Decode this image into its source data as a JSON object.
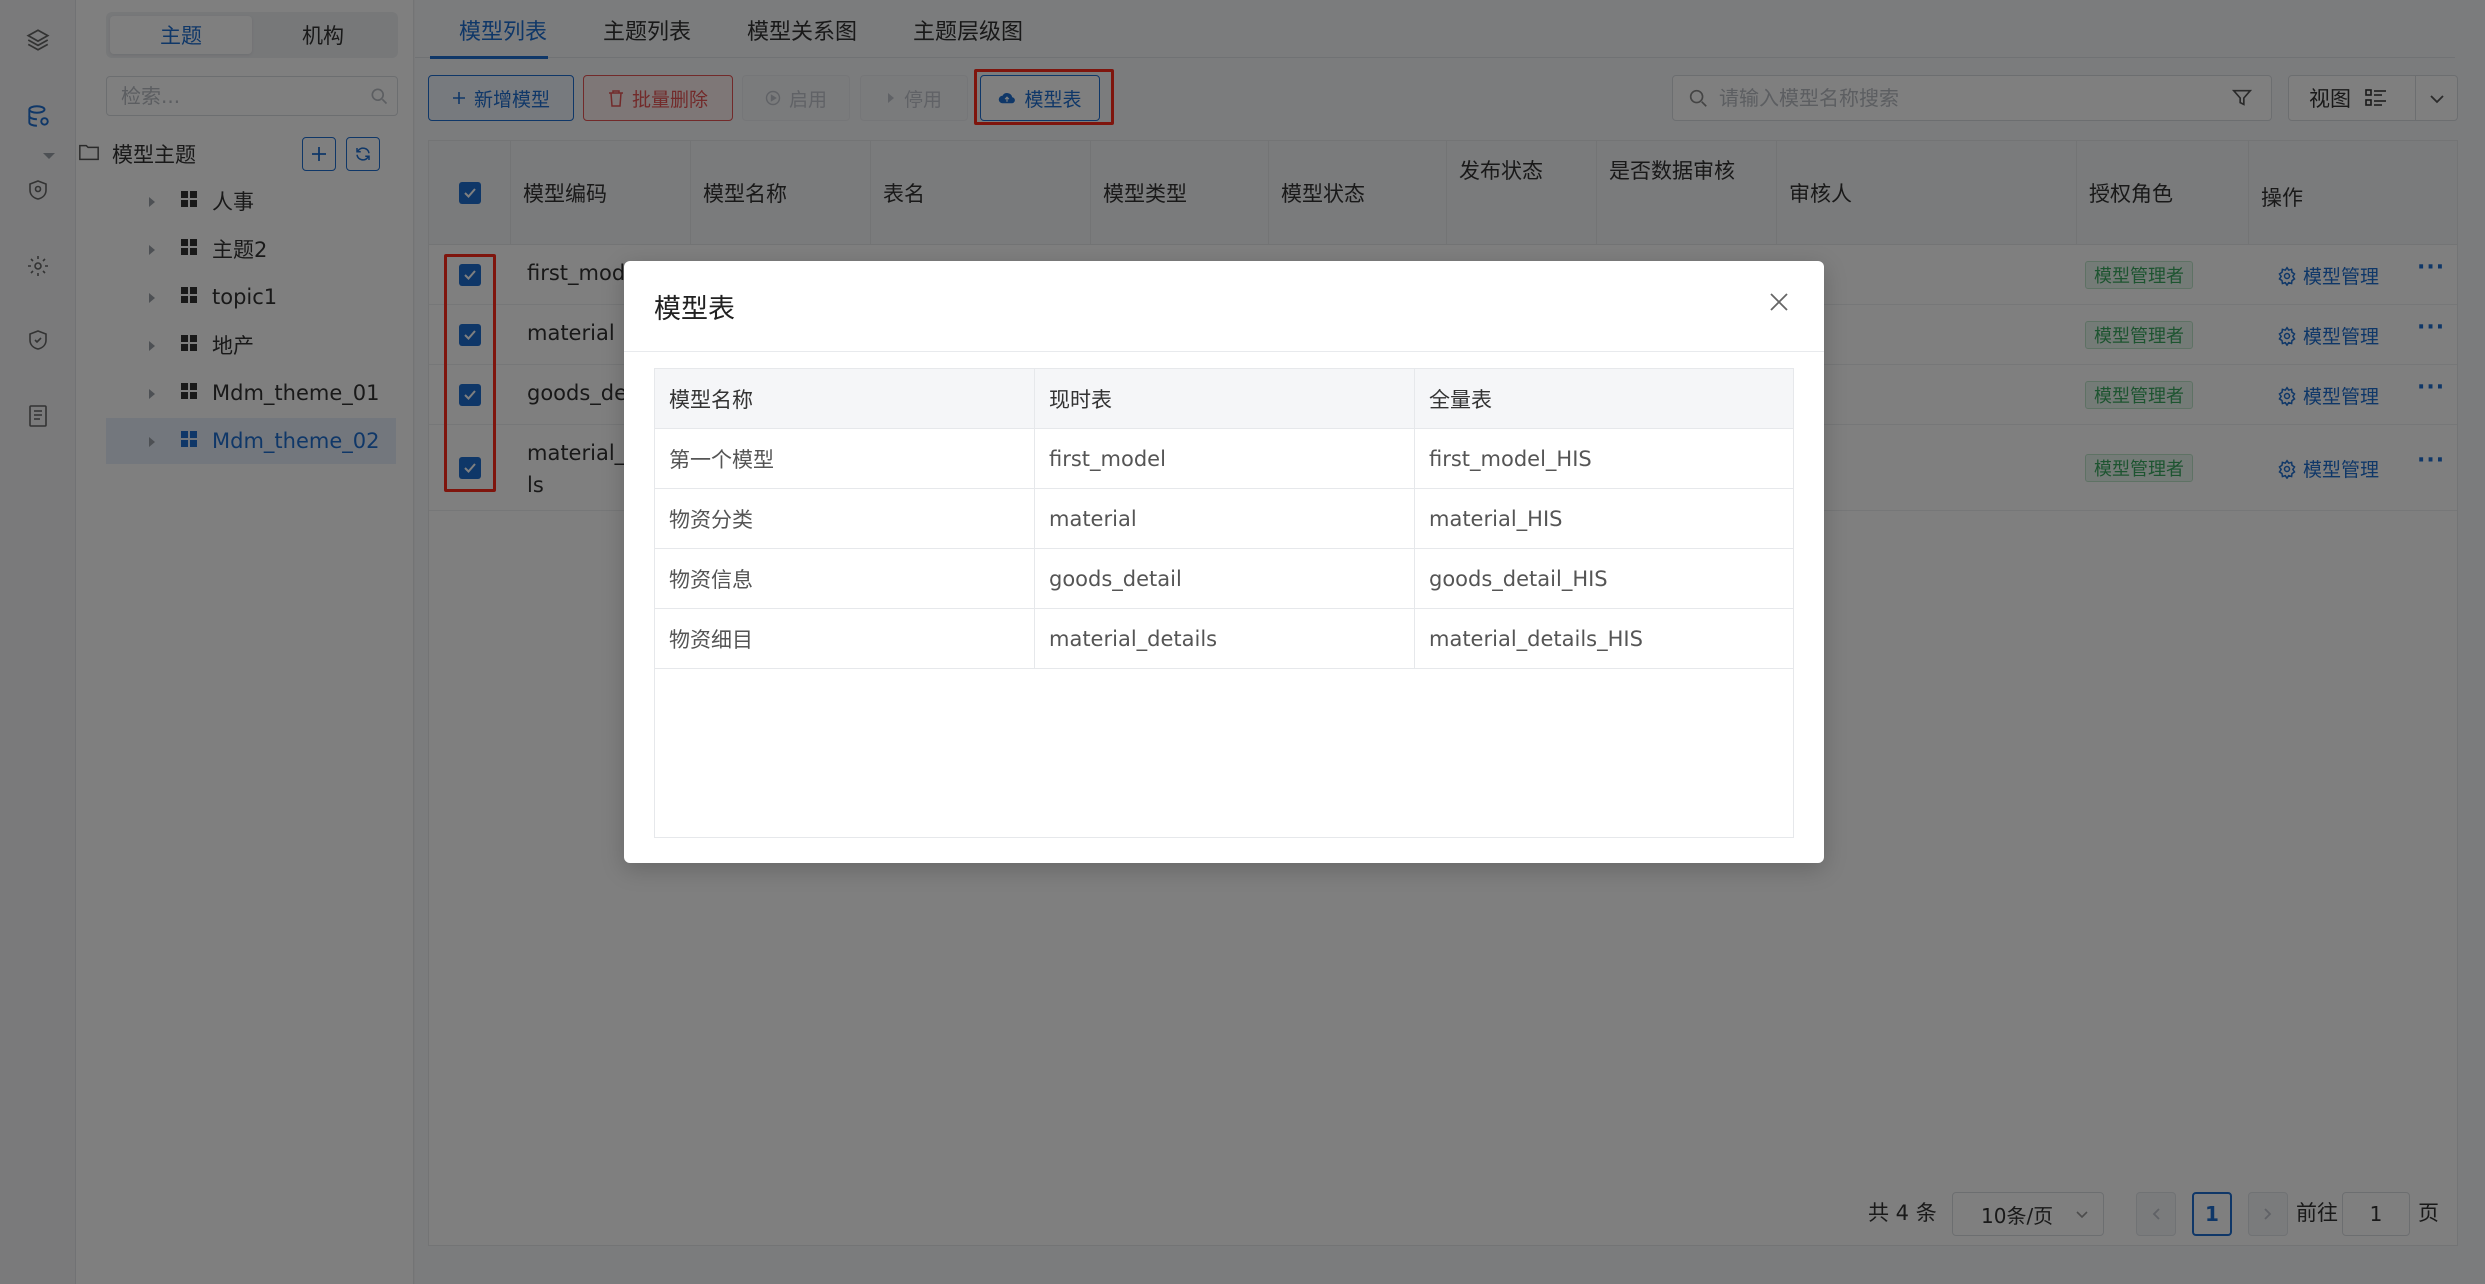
{
  "sidebar_toggle": {
    "left": "主题",
    "right": "机构"
  },
  "left_search": {
    "placeholder": "检索..."
  },
  "tree": {
    "root": "模型主题",
    "items": [
      "人事",
      "主题2",
      "topic1",
      "地产",
      "Mdm_theme_01",
      "Mdm_theme_02"
    ],
    "selected_index": 5
  },
  "tabs": [
    "模型列表",
    "主题列表",
    "模型关系图",
    "主题层级图"
  ],
  "toolbar": {
    "add": "新增模型",
    "batch_delete": "批量删除",
    "enable": "启用",
    "disable": "停用",
    "model_table": "模型表"
  },
  "top_search": {
    "placeholder": "请输入模型名称搜索"
  },
  "view_label": "视图",
  "table": {
    "headers": [
      "模型编码",
      "模型名称",
      "表名",
      "模型类型",
      "模型状态",
      "发布状态",
      "是否数据审核",
      "审核人",
      "授权角色",
      "操作"
    ],
    "rows": [
      {
        "code": "first_mode",
        "role": "模型管理者",
        "op": "模型管理"
      },
      {
        "code": "material",
        "role": "模型管理者",
        "op": "模型管理"
      },
      {
        "code": "goods_det",
        "role": "模型管理者",
        "op": "模型管理"
      },
      {
        "code_line1": "material_d",
        "code_line2": "ls",
        "role": "模型管理者",
        "op": "模型管理"
      }
    ],
    "more_glyph": "···"
  },
  "pagination": {
    "total": "共 4 条",
    "page_size": "10条/页",
    "current": "1",
    "goto_prefix": "前往",
    "goto_value": "1",
    "goto_suffix": "页"
  },
  "modal": {
    "title": "模型表",
    "headers": [
      "模型名称",
      "现时表",
      "全量表"
    ],
    "rows": [
      [
        "第一个模型",
        "first_model",
        "first_model_HIS"
      ],
      [
        "物资分类",
        "material",
        "material_HIS"
      ],
      [
        "物资信息",
        "goods_detail",
        "goods_detail_HIS"
      ],
      [
        "物资细目",
        "material_details",
        "material_details_HIS"
      ]
    ]
  },
  "colors": {
    "accent": "#1f6fd1",
    "danger": "#e55555",
    "highlight_box": "#ff2a1a",
    "role_tag": "#3aa860"
  }
}
